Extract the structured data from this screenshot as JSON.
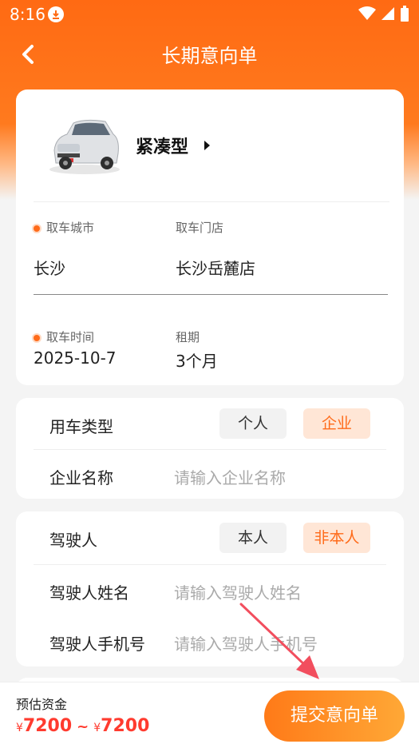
{
  "status_bar": {
    "time": "8:16"
  },
  "header": {
    "title": "长期意向单"
  },
  "car": {
    "type_label": "紧凑型"
  },
  "pickup": {
    "city_label": "取车城市",
    "city_value": "长沙",
    "store_label": "取车门店",
    "store_value": "长沙岳麓店",
    "time_label": "取车时间",
    "time_value": "2025-10-7",
    "duration_label": "租期",
    "duration_value": "3个月"
  },
  "usage": {
    "type_label": "用车类型",
    "options": [
      "个人",
      "企业"
    ],
    "selected": "企业",
    "company_label": "企业名称",
    "company_placeholder": "请输入企业名称"
  },
  "driver": {
    "label": "驾驶人",
    "options": [
      "本人",
      "非本人"
    ],
    "selected": "非本人",
    "name_label": "驾驶人姓名",
    "name_placeholder": "请输入驾驶人姓名",
    "phone_label": "驾驶人手机号",
    "phone_placeholder": "请输入驾驶人手机号"
  },
  "footer": {
    "estimate_label": "预估资金",
    "currency": "¥",
    "min_price": "7200",
    "separator": "~",
    "max_price": "7200",
    "submit_label": "提交意向单"
  },
  "colors": {
    "accent": "#ff6b1a",
    "price": "#ff3b2f",
    "annotation_arrow": "#f24e5e"
  }
}
